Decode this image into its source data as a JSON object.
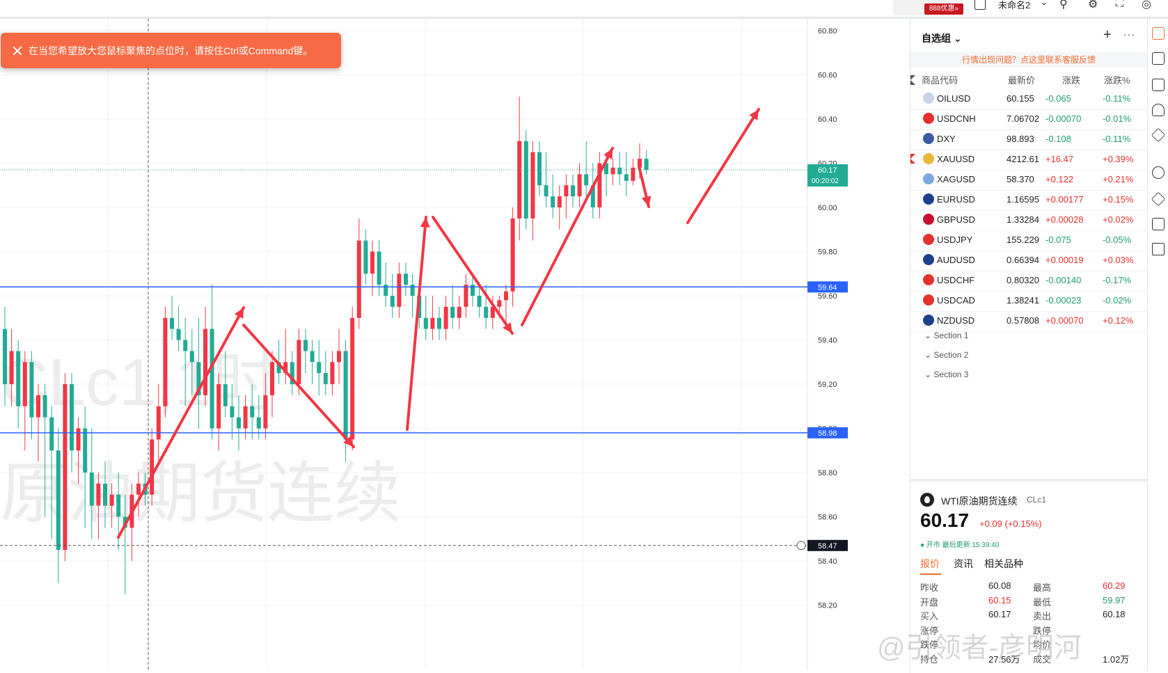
{
  "topbar": {
    "ad_badge": "888优惠»",
    "layout_title": "未命名2",
    "icons": [
      "checkbox-icon",
      "chevron-down-icon",
      "alert-icon",
      "settings-icon",
      "fullscreen-icon",
      "camera-icon"
    ]
  },
  "toast": {
    "message": "在当您希望放大您鼠标聚焦的点位时，请按住Ctrl或Command键。"
  },
  "chart": {
    "watermark_symbol": "CLc1,1时",
    "watermark_name": "原油期货连续",
    "last_price_label": "60.17",
    "countdown_label": "00:20:02",
    "hline_upper_label": "59.64",
    "hline_lower_label": "58.98",
    "crosshair_label": "58.47",
    "colors": {
      "up": "#f23645",
      "down": "#22ab94",
      "hline": "#2962ff",
      "arrow": "#f23645"
    }
  },
  "chart_data": {
    "type": "candlestick",
    "yticks": [
      "60.80",
      "60.60",
      "60.40",
      "60.20",
      "60.00",
      "59.80",
      "59.60",
      "59.40",
      "59.20",
      "59.00",
      "58.80",
      "58.60",
      "58.40",
      "58.20"
    ],
    "ylim": [
      58.2,
      60.8
    ],
    "horizontal_lines": [
      59.64,
      58.98
    ],
    "last_price": 60.17,
    "ohlc": [
      [
        59.45,
        59.55,
        59.1,
        59.2
      ],
      [
        59.2,
        59.45,
        59.1,
        59.35
      ],
      [
        59.35,
        59.4,
        59.0,
        59.1
      ],
      [
        59.1,
        59.35,
        58.9,
        59.3
      ],
      [
        59.3,
        59.35,
        58.95,
        59.05
      ],
      [
        59.05,
        59.2,
        58.85,
        59.15
      ],
      [
        59.15,
        59.2,
        58.6,
        59.05
      ],
      [
        59.05,
        59.1,
        58.5,
        58.9
      ],
      [
        58.9,
        59.0,
        58.3,
        58.45
      ],
      [
        58.45,
        59.25,
        58.4,
        59.2
      ],
      [
        59.2,
        59.25,
        58.8,
        58.9
      ],
      [
        58.9,
        59.05,
        58.75,
        59.0
      ],
      [
        59.0,
        59.1,
        58.55,
        58.8
      ],
      [
        58.8,
        59.0,
        58.5,
        58.65
      ],
      [
        58.65,
        58.8,
        58.5,
        58.75
      ],
      [
        58.75,
        58.85,
        58.55,
        58.65
      ],
      [
        58.65,
        58.75,
        58.55,
        58.7
      ],
      [
        58.7,
        58.8,
        58.45,
        58.6
      ],
      [
        58.6,
        58.7,
        58.25,
        58.55
      ],
      [
        58.55,
        58.75,
        58.4,
        58.7
      ],
      [
        58.7,
        58.8,
        58.6,
        58.75
      ],
      [
        58.75,
        58.8,
        58.65,
        58.7
      ],
      [
        58.7,
        59.0,
        58.65,
        58.95
      ],
      [
        58.95,
        59.2,
        58.85,
        59.1
      ],
      [
        59.1,
        59.55,
        59.05,
        59.5
      ],
      [
        59.5,
        59.6,
        59.4,
        59.45
      ],
      [
        59.45,
        59.55,
        59.35,
        59.4
      ],
      [
        59.4,
        59.5,
        59.1,
        59.35
      ],
      [
        59.35,
        59.45,
        59.15,
        59.3
      ],
      [
        59.3,
        59.5,
        59.0,
        59.15
      ],
      [
        59.15,
        59.55,
        59.1,
        59.45
      ],
      [
        59.45,
        59.65,
        58.95,
        59.0
      ],
      [
        59.0,
        59.25,
        58.9,
        59.2
      ],
      [
        59.2,
        59.35,
        59.05,
        59.1
      ],
      [
        59.1,
        59.2,
        58.95,
        59.05
      ],
      [
        59.05,
        59.15,
        58.9,
        59.0
      ],
      [
        59.0,
        59.15,
        58.95,
        59.1
      ],
      [
        59.1,
        59.2,
        58.95,
        59.05
      ],
      [
        59.05,
        59.15,
        58.95,
        59.0
      ],
      [
        59.0,
        59.25,
        58.95,
        59.15
      ],
      [
        59.15,
        59.35,
        59.05,
        59.3
      ],
      [
        59.3,
        59.4,
        59.2,
        59.25
      ],
      [
        59.25,
        59.45,
        59.2,
        59.3
      ],
      [
        59.3,
        59.35,
        59.15,
        59.2
      ],
      [
        59.2,
        59.45,
        59.15,
        59.4
      ],
      [
        59.4,
        59.45,
        59.25,
        59.35
      ],
      [
        59.35,
        59.4,
        59.2,
        59.3
      ],
      [
        59.3,
        59.4,
        59.15,
        59.25
      ],
      [
        59.25,
        59.35,
        59.15,
        59.2
      ],
      [
        59.2,
        59.35,
        59.15,
        59.3
      ],
      [
        59.3,
        59.45,
        59.2,
        59.35
      ],
      [
        59.35,
        59.4,
        58.85,
        58.95
      ],
      [
        58.95,
        59.55,
        58.9,
        59.5
      ],
      [
        59.5,
        59.95,
        59.45,
        59.85
      ],
      [
        59.85,
        59.9,
        59.65,
        59.7
      ],
      [
        59.7,
        59.85,
        59.6,
        59.8
      ],
      [
        59.8,
        59.85,
        59.6,
        59.65
      ],
      [
        59.65,
        59.75,
        59.55,
        59.6
      ],
      [
        59.6,
        59.7,
        59.5,
        59.55
      ],
      [
        59.55,
        59.75,
        59.5,
        59.7
      ],
      [
        59.7,
        59.75,
        59.6,
        59.65
      ],
      [
        59.65,
        59.7,
        59.5,
        59.6
      ],
      [
        59.6,
        59.65,
        59.45,
        59.5
      ],
      [
        59.5,
        59.6,
        59.4,
        59.45
      ],
      [
        59.45,
        59.6,
        59.4,
        59.5
      ],
      [
        59.5,
        59.55,
        59.4,
        59.45
      ],
      [
        59.45,
        59.6,
        59.4,
        59.55
      ],
      [
        59.55,
        59.65,
        59.45,
        59.5
      ],
      [
        59.5,
        59.6,
        59.45,
        59.55
      ],
      [
        59.55,
        59.7,
        59.5,
        59.65
      ],
      [
        59.65,
        59.7,
        59.55,
        59.6
      ],
      [
        59.6,
        59.65,
        59.5,
        59.55
      ],
      [
        59.55,
        59.65,
        59.45,
        59.5
      ],
      [
        59.5,
        59.6,
        59.45,
        59.55
      ],
      [
        59.55,
        59.6,
        59.5,
        59.58
      ],
      [
        59.58,
        59.65,
        59.48,
        59.62
      ],
      [
        59.62,
        60.0,
        59.55,
        59.95
      ],
      [
        59.95,
        60.5,
        59.85,
        60.3
      ],
      [
        60.3,
        60.35,
        59.9,
        59.95
      ],
      [
        59.95,
        60.3,
        59.85,
        60.25
      ],
      [
        60.25,
        60.3,
        60.05,
        60.1
      ],
      [
        60.1,
        60.25,
        60.0,
        60.05
      ],
      [
        60.05,
        60.15,
        59.95,
        60.0
      ],
      [
        60.0,
        60.1,
        59.9,
        60.05
      ],
      [
        60.05,
        60.15,
        59.95,
        60.1
      ],
      [
        60.1,
        60.15,
        60.0,
        60.05
      ],
      [
        60.05,
        60.2,
        60.0,
        60.15
      ],
      [
        60.15,
        60.3,
        60.05,
        60.1
      ],
      [
        60.1,
        60.2,
        59.95,
        60.0
      ],
      [
        60.0,
        60.25,
        59.95,
        60.2
      ],
      [
        60.2,
        60.25,
        60.05,
        60.15
      ],
      [
        60.15,
        60.22,
        60.1,
        60.18
      ],
      [
        60.18,
        60.25,
        60.1,
        60.15
      ],
      [
        60.15,
        60.25,
        60.05,
        60.12
      ],
      [
        60.12,
        60.22,
        60.1,
        60.18
      ],
      [
        60.18,
        60.29,
        60.13,
        60.22
      ],
      [
        60.22,
        60.26,
        60.15,
        60.17
      ]
    ],
    "annotations": "hand-drawn red arrows"
  },
  "watchlist": {
    "title": "自选组",
    "feedback": "行情出现问题？点这里联系客服反馈",
    "columns": [
      "商品代码",
      "最新价",
      "涨跌",
      "涨跌%"
    ],
    "rows": [
      {
        "symbol": "OILUSD",
        "price": "60.155",
        "change": "-0.065",
        "pct": "-0.11%",
        "dir": "down",
        "icon": "#c9d3e6"
      },
      {
        "symbol": "USDCNH",
        "price": "7.06702",
        "change": "-0.00070",
        "pct": "-0.01%",
        "dir": "down",
        "icon": "#e5302e"
      },
      {
        "symbol": "DXY",
        "price": "98.893",
        "change": "-0.108",
        "pct": "-0.11%",
        "dir": "down",
        "icon": "#3c5aa6"
      },
      {
        "symbol": "XAUUSD",
        "price": "4212.61",
        "change": "+16.47",
        "pct": "+0.39%",
        "dir": "up",
        "icon": "#e9b73a"
      },
      {
        "symbol": "XAGUSD",
        "price": "58.370",
        "change": "+0.122",
        "pct": "+0.21%",
        "dir": "up",
        "icon": "#7fa8e0"
      },
      {
        "symbol": "EURUSD",
        "price": "1.16595",
        "change": "+0.00177",
        "pct": "+0.15%",
        "dir": "up",
        "icon": "#1e3f8a"
      },
      {
        "symbol": "GBPUSD",
        "price": "1.33284",
        "change": "+0.00028",
        "pct": "+0.02%",
        "dir": "up",
        "icon": "#c8102e"
      },
      {
        "symbol": "USDJPY",
        "price": "155.229",
        "change": "-0.075",
        "pct": "-0.05%",
        "dir": "down",
        "icon": "#e5302e"
      },
      {
        "symbol": "AUDUSD",
        "price": "0.66394",
        "change": "+0.00019",
        "pct": "+0.03%",
        "dir": "up",
        "icon": "#1e3f8a"
      },
      {
        "symbol": "USDCHF",
        "price": "0.80320",
        "change": "-0.00140",
        "pct": "-0.17%",
        "dir": "down",
        "icon": "#e5302e"
      },
      {
        "symbol": "USDCAD",
        "price": "1.38241",
        "change": "-0.00023",
        "pct": "-0.02%",
        "dir": "down",
        "icon": "#e5302e"
      },
      {
        "symbol": "NZDUSD",
        "price": "0.57808",
        "change": "+0.00070",
        "pct": "+0.12%",
        "dir": "up",
        "icon": "#1e3f8a"
      }
    ],
    "sections": [
      "Section 1",
      "Section 2",
      "Section 3"
    ]
  },
  "quote": {
    "name": "WTI原油期货连续",
    "symbol": "CLc1",
    "price": "60.17",
    "change": "+0.09 (+0.15%)",
    "status": "● 开市  最后更新:15:39:40",
    "tabs": [
      "报价",
      "资讯",
      "相关品种"
    ],
    "rows": [
      {
        "l1": "昨收",
        "v1": "60.08",
        "c1": "#222",
        "l2": "最高",
        "v2": "60.29",
        "c2": "#e5302e"
      },
      {
        "l1": "开盘",
        "v1": "60.15",
        "c1": "#e5302e",
        "l2": "最低",
        "v2": "59.97",
        "c2": "#1f9c6b"
      },
      {
        "l1": "买入",
        "v1": "60.17",
        "c1": "#222",
        "l2": "卖出",
        "v2": "60.18",
        "c2": "#222"
      },
      {
        "l1": "涨停",
        "v1": "",
        "c1": "#222",
        "l2": "跌停",
        "v2": "",
        "c2": "#222"
      },
      {
        "l1": "跌停",
        "v1": "",
        "c1": "#222",
        "l2": "均价",
        "v2": "",
        "c2": "#222"
      },
      {
        "l1": "持仓",
        "v1": "27.56万",
        "c1": "#222",
        "l2": "成交",
        "v2": "1.02万",
        "c2": "#222"
      }
    ]
  },
  "watermark": "@引领者-彦明河"
}
